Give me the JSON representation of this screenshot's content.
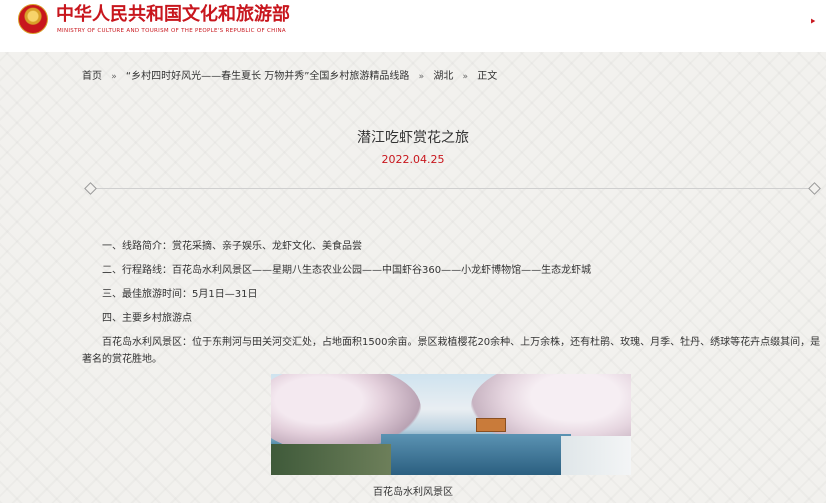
{
  "header": {
    "logo_cn": "中华人民共和国文化和旅游部",
    "logo_en": "MINISTRY OF CULTURE AND TOURISM OF THE PEOPLE'S REPUBLIC OF CHINA",
    "emblem_icon": "national-emblem-icon",
    "corner_icon": "emblem-icon",
    "brand_color": "#c8161d"
  },
  "breadcrumb": {
    "items": [
      "首页",
      "“乡村四时好风光——春生夏长 万物并秀”全国乡村旅游精品线路",
      "湖北",
      "正文"
    ],
    "separator": "»"
  },
  "article": {
    "title": "潜江吃虾赏花之旅",
    "date": "2022.04.25",
    "date_color": "#c8161d",
    "paragraphs": [
      "一、线路简介：赏花采摘、亲子娱乐、龙虾文化、美食品尝",
      "二、行程路线：百花岛水利风景区——星期八生态农业公园——中国虾谷360——小龙虾博物馆——生态龙虾城",
      "三、最佳旅游时间：5月1日—31日",
      "四、主要乡村旅游点",
      "百花岛水利风景区：位于东荆河与田关河交汇处，占地面积1500余亩。景区栽植樱花20余种、上万余株，还有杜鹃、玫瑰、月季、牡丹、绣球等花卉点缀其间，是著名的赏花胜地。"
    ],
    "image_caption": "百花岛水利风景区"
  }
}
